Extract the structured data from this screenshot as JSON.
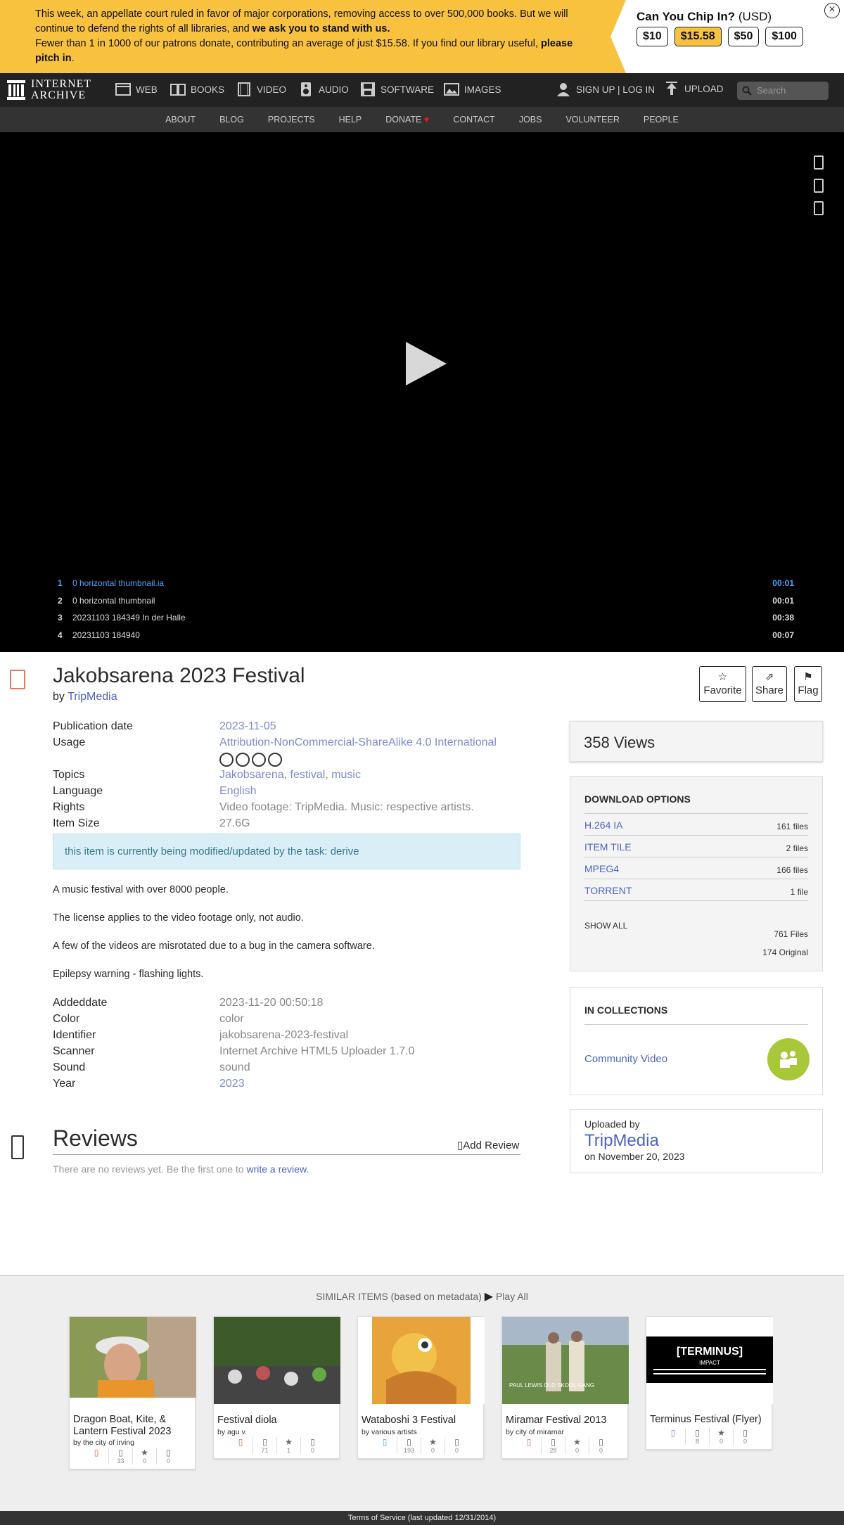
{
  "banner": {
    "msg_part1": "This week, an appellate court ruled in favor of major corporations, removing access to over 500,000 books. But we will continue to defend the rights of all libraries, and ",
    "msg_bold1": "we ask you to stand with us.",
    "msg_part2": "Fewer than 1 in 1000 of our patrons donate, contributing an average of just $15.58. If you find our library useful, ",
    "msg_bold2": "please pitch in",
    "msg_end": ".",
    "chip_title": "Can You Chip In?",
    "chip_currency": "(USD)",
    "amounts": [
      "$10",
      "$15.58",
      "$50",
      "$100"
    ],
    "close": "×"
  },
  "nav": {
    "logo_line1": "INTERNET",
    "logo_line2": "ARCHIVE",
    "items": [
      "WEB",
      "BOOKS",
      "VIDEO",
      "AUDIO",
      "SOFTWARE",
      "IMAGES"
    ],
    "signup": "SIGN UP | LOG IN",
    "upload": "UPLOAD",
    "search_placeholder": "Search"
  },
  "subnav": [
    "ABOUT",
    "BLOG",
    "PROJECTS",
    "HELP",
    "DONATE",
    "CONTACT",
    "JOBS",
    "VOLUNTEER",
    "PEOPLE"
  ],
  "playlist": [
    {
      "n": "1",
      "title": "0 horizontal thumbnail.ia",
      "dur": "00:01"
    },
    {
      "n": "2",
      "title": "0 horizontal thumbnail",
      "dur": "00:01"
    },
    {
      "n": "3",
      "title": "20231103 184349 In der Halle",
      "dur": "00:38"
    },
    {
      "n": "4",
      "title": "20231103 184940",
      "dur": "00:07"
    }
  ],
  "item": {
    "title": "Jakobsarena 2023 Festival",
    "by_label": "by",
    "creator": "TripMedia",
    "actions": {
      "favorite": "Favorite",
      "share": "Share",
      "flag": "Flag"
    },
    "meta": {
      "pubdate_k": "Publication date",
      "pubdate_v": "2023-11-05",
      "usage_k": "Usage",
      "usage_v": "Attribution-NonCommercial-ShareAlike 4.0 International",
      "topics_k": "Topics",
      "topic1": "Jakobsarena",
      "topic2": "festival",
      "topic3": "music",
      "language_k": "Language",
      "language_v": "English",
      "rights_k": "Rights",
      "rights_v": "Video footage: TripMedia. Music: respective artists.",
      "size_k": "Item Size",
      "size_v": "27.6G"
    },
    "notice": "this item is currently being modified/updated by the task: derive",
    "description": [
      "A music festival with over 8000 people.",
      "The license applies to the video footage only, not audio.",
      "A few of the videos are misrotated due to a bug in the camera software.",
      "Epilepsy warning - flashing lights."
    ],
    "meta2": {
      "added_k": "Addeddate",
      "added_v": "2023-11-20 00:50:18",
      "color_k": "Color",
      "color_v": "color",
      "id_k": "Identifier",
      "id_v": "jakobsarena-2023-festival",
      "scanner_k": "Scanner",
      "scanner_v": "Internet Archive HTML5 Uploader 1.7.0",
      "sound_k": "Sound",
      "sound_v": "sound",
      "year_k": "Year",
      "year_v": "2023"
    },
    "reviews_title": "Reviews",
    "add_review": "Add Review",
    "no_reviews": "There are no reviews yet. Be the first one to ",
    "write_review": "write a review."
  },
  "sidebar": {
    "views": "358 Views",
    "dl_title": "DOWNLOAD OPTIONS",
    "downloads": [
      {
        "name": "H.264 IA",
        "count": "161 files"
      },
      {
        "name": "ITEM TILE",
        "count": "2 files"
      },
      {
        "name": "MPEG4",
        "count": "166 files"
      },
      {
        "name": "TORRENT",
        "count": "1 file"
      }
    ],
    "show_all": "SHOW ALL",
    "total_files": "761 Files",
    "original": "174 Original",
    "coll_title": "IN COLLECTIONS",
    "collection": "Community Video",
    "uploaded_by": "Uploaded by",
    "uploader": "TripMedia",
    "upload_date": "on November 20, 2023"
  },
  "similar": {
    "heading": "SIMILAR ITEMS (based on metadata)",
    "play_all": "Play All",
    "cards": [
      {
        "title": "Dragon Boat, Kite, & Lantern Festival 2023",
        "by": "by the city of irving",
        "views": "33",
        "favs": "0",
        "reviews": "0"
      },
      {
        "title": "Festival diola",
        "by": "by agu v.",
        "views": "71",
        "favs": "1",
        "reviews": "0"
      },
      {
        "title": "Wataboshi 3 Festival",
        "by": "by various artists",
        "views": "193",
        "favs": "0",
        "reviews": "0"
      },
      {
        "title": "Miramar Festival 2013",
        "by": "by city of miramar",
        "views": "28",
        "favs": "0",
        "reviews": "0"
      },
      {
        "title": "Terminus Festival (Flyer)",
        "by": "",
        "views": "8",
        "favs": "0",
        "reviews": "0"
      }
    ],
    "flyer_text": "[TERMINUS]",
    "flyer_sub": "IMPACT",
    "poster_text": "PAUL LEWIS OLD SKOOL GANG"
  },
  "footer": "Terms of Service (last updated 12/31/2014)",
  "colors": {
    "banner": "#f8c23f",
    "link": "#4b64c4",
    "nav_bg": "#222222",
    "collection_badge": "#a8c83a"
  }
}
